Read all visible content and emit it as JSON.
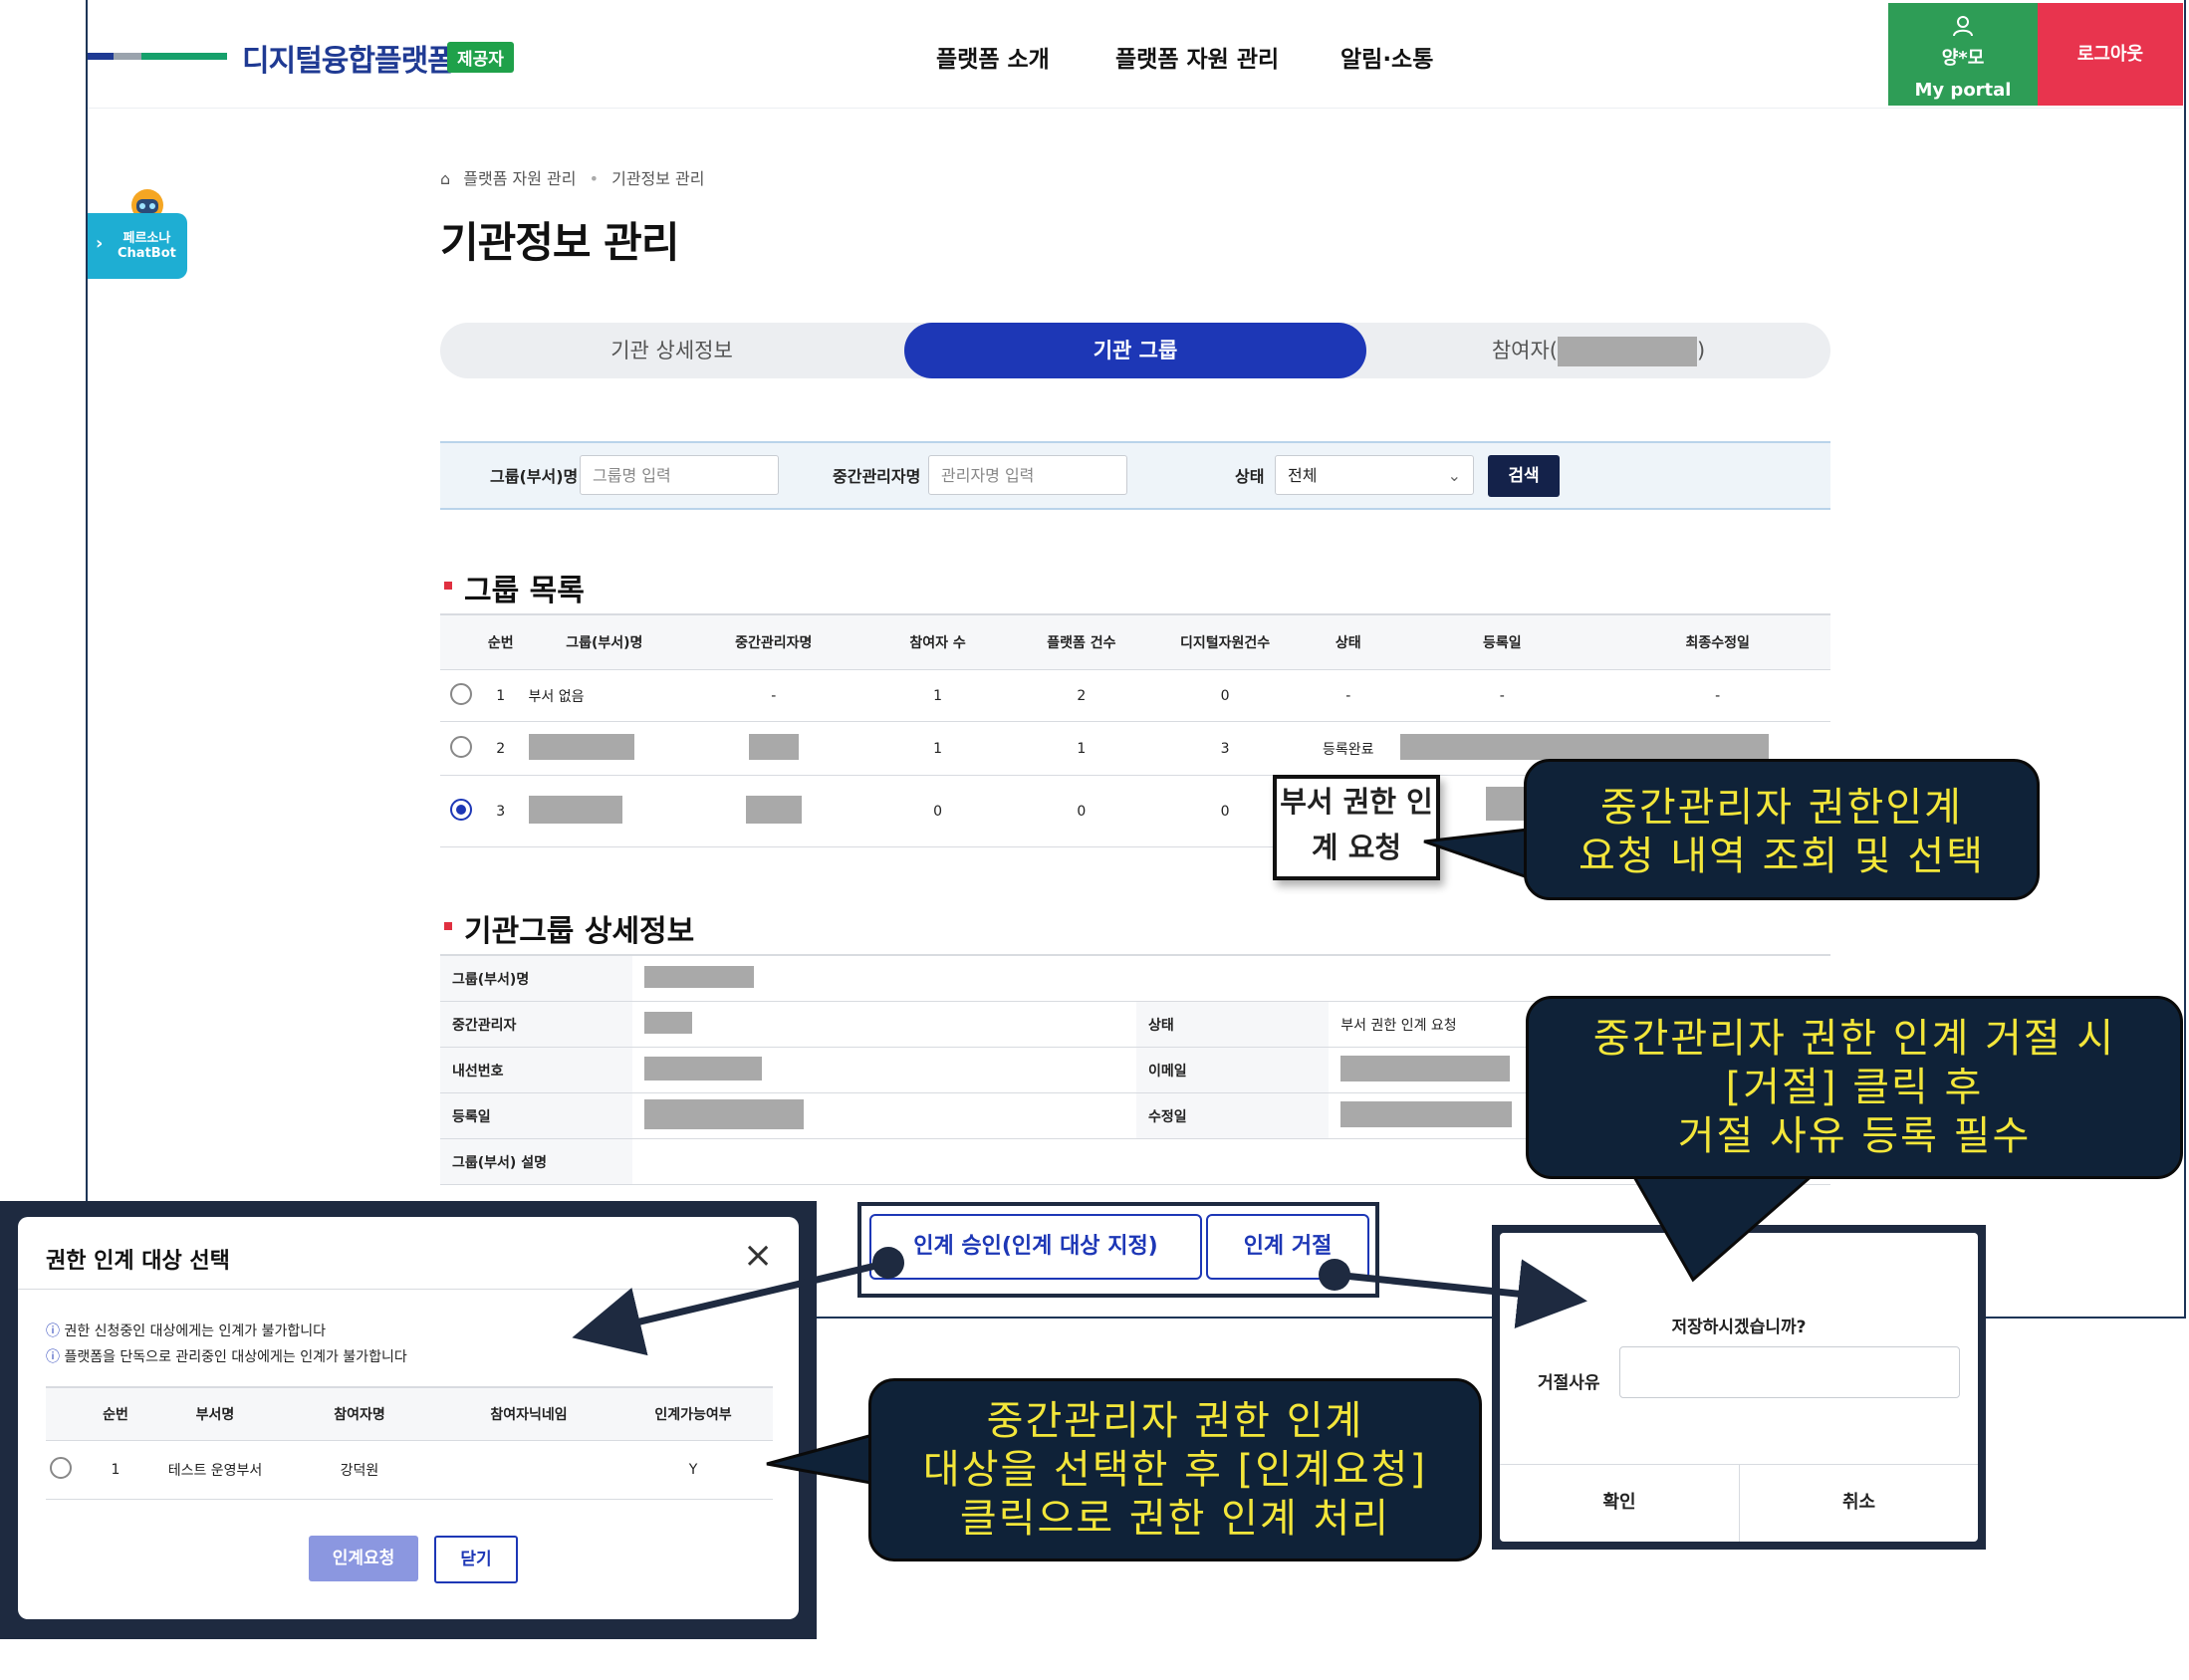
{
  "header": {
    "logo": "디지털융합플랫폼",
    "badge": "제공자",
    "nav": [
      "플랫폼 소개",
      "플랫폼 자원 관리",
      "알림·소통"
    ],
    "user_name": "양*모",
    "my_portal": "My portal",
    "logout": "로그아웃"
  },
  "chatbot": {
    "line1": "페르소나",
    "line2": "ChatBot"
  },
  "breadcrumb": {
    "item1": "플랫폼 자원 관리",
    "item2": "기관정보 관리"
  },
  "page_title": "기관정보 관리",
  "tabs": {
    "detail": "기관 상세정보",
    "group": "기관 그룹",
    "participant_prefix": "참여자(",
    "participant_suffix": ")"
  },
  "filter": {
    "group_label": "그룹(부서)명",
    "group_placeholder": "그룹명 입력",
    "manager_label": "중간관리자명",
    "manager_placeholder": "관리자명 입력",
    "status_label": "상태",
    "status_value": "전체",
    "search": "검색"
  },
  "group_list": {
    "title": "그룹 목록",
    "columns": [
      "순번",
      "그룹(부서)명",
      "중간관리자명",
      "참여자 수",
      "플랫폼 건수",
      "디지털자원건수",
      "상태",
      "등록일",
      "최종수정일"
    ],
    "rows": [
      {
        "no": "1",
        "name": "부서 없음",
        "manager": "-",
        "participants": "1",
        "platforms": "2",
        "resources": "0",
        "status": "-",
        "reg": "-",
        "mod": "-"
      },
      {
        "no": "2",
        "participants": "1",
        "platforms": "1",
        "resources": "3",
        "status": "등록완료"
      },
      {
        "no": "3",
        "participants": "0",
        "platforms": "0",
        "resources": "0",
        "status_line1": "부서 권한 인",
        "status_line2": "계 요청"
      }
    ]
  },
  "group_detail": {
    "title": "기관그룹 상세정보",
    "labels": {
      "name": "그룹(부서)명",
      "manager": "중간관리자",
      "status": "상태",
      "ext": "내선번호",
      "email": "이메일",
      "reg": "등록일",
      "mod": "수정일",
      "desc": "그룹(부서) 설명"
    },
    "status_value": "부서 권한 인계 요청"
  },
  "actions": {
    "approve": "인계 승인(인계 대상 지정)",
    "reject": "인계 거절"
  },
  "modal": {
    "title": "권한 인계 대상 선택",
    "notice1": "권한 신청중인 대상에게는 인계가 불가합니다",
    "notice2": "플랫폼을 단독으로 관리중인 대상에게는 인계가 불가합니다",
    "columns": [
      "순번",
      "부서명",
      "참여자명",
      "참여자닉네임",
      "인계가능여부"
    ],
    "rows": [
      {
        "no": "1",
        "dept": "테스트 운영부서",
        "name": "강덕원",
        "nick": "",
        "able": "Y"
      }
    ],
    "request": "인계요청",
    "close": "닫기"
  },
  "reject_dialog": {
    "question": "저장하시겠습니까?",
    "reason_label": "거절사유",
    "confirm": "확인",
    "cancel": "취소"
  },
  "callouts": {
    "c1_l1": "중간관리자 권한인계",
    "c1_l2": "요청 내역 조회 및 선택",
    "c2_l1": "중간관리자 권한 인계 거절 시",
    "c2_l2": "[거절] 클릭 후",
    "c2_l3": "거절 사유 등록 필수",
    "c3_l1": "중간관리자 권한 인계",
    "c3_l2": "대상을 선택한 후 [인계요청]",
    "c3_l3": "클릭으로 권한 인계 처리"
  },
  "colors": {
    "primary": "#1d37b6",
    "portal": "#2e9d56",
    "logout": "#e8344e",
    "callout_bg": "#0f2238",
    "callout_text": "#f3e63a"
  }
}
